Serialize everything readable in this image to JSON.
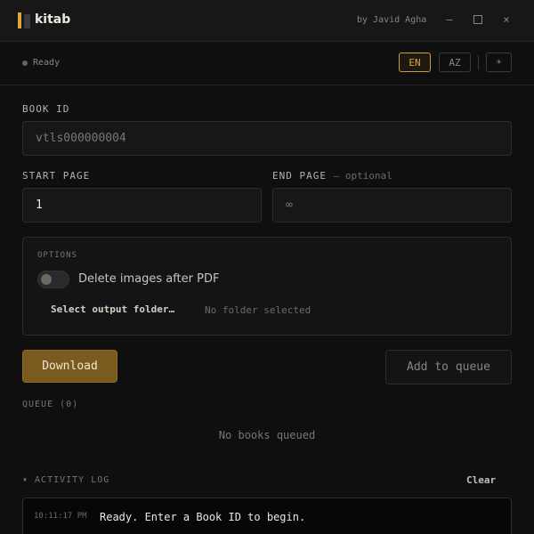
{
  "window": {
    "title": "kitab",
    "byline": "by Javid Agha",
    "controls": {
      "minimize": "–",
      "close": "×"
    },
    "logo_icon": "book-spine-icon",
    "accent_color": "#e0a63a"
  },
  "status": {
    "text": "Ready",
    "languages": [
      "EN",
      "AZ"
    ],
    "active_language": "EN",
    "theme_icon": "☀"
  },
  "form": {
    "book_id": {
      "label": "BOOK ID",
      "placeholder": "vtls000000004",
      "value": ""
    },
    "start_page": {
      "label": "START PAGE",
      "value": "1"
    },
    "end_page": {
      "label": "END PAGE",
      "optional_note": "— optional",
      "placeholder": "∞",
      "value": ""
    }
  },
  "options": {
    "title": "OPTIONS",
    "delete_images_label": "Delete images after PDF",
    "delete_images_enabled": false,
    "select_folder_label": "Select output folder…",
    "folder_status": "No folder selected"
  },
  "actions": {
    "download_label": "Download",
    "add_to_queue_label": "Add to queue"
  },
  "queue": {
    "title": "QUEUE (0)",
    "empty_text": "No books queued"
  },
  "activity_log": {
    "title": "▾ ACTIVITY LOG",
    "clear_label": "Clear",
    "entries": [
      {
        "time": "10:11:17 PM",
        "message": "Ready. Enter a Book ID to begin."
      }
    ]
  }
}
